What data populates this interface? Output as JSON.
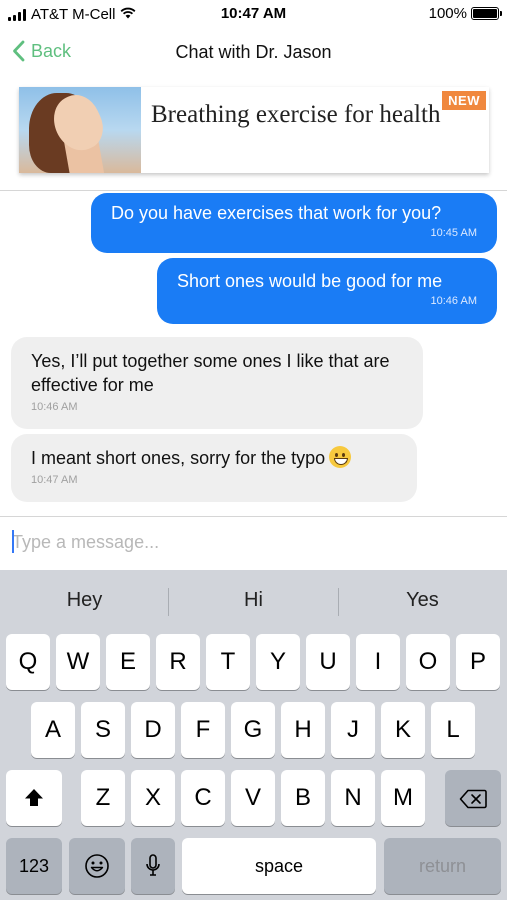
{
  "status_bar": {
    "carrier": "AT&T M-Cell",
    "time": "10:47 AM",
    "battery": "100%",
    "battery_level": 1.0
  },
  "nav": {
    "back_label": "Back",
    "title": "Chat with Dr. Jason"
  },
  "banner": {
    "title": "Breathing exercise for health",
    "badge": "NEW"
  },
  "messages": [
    {
      "direction": "outgoing",
      "text": "Do you have exercises that work for you?",
      "time": "10:45 AM"
    },
    {
      "direction": "outgoing",
      "text": "Short ones would be good for me",
      "time": "10:46 AM"
    },
    {
      "direction": "incoming",
      "text": "Yes, I’ll put together some ones I like that are effective for me",
      "time": "10:46 AM"
    },
    {
      "direction": "incoming",
      "text": "I meant short ones, sorry for the typo",
      "time": "10:47 AM",
      "emoji": "grinning-face"
    }
  ],
  "input": {
    "placeholder": "Type a message..."
  },
  "keyboard": {
    "suggestions": [
      "Hey",
      "Hi",
      "Yes"
    ],
    "row1": [
      "Q",
      "W",
      "E",
      "R",
      "T",
      "Y",
      "U",
      "I",
      "O",
      "P"
    ],
    "row2": [
      "A",
      "S",
      "D",
      "F",
      "G",
      "H",
      "J",
      "K",
      "L"
    ],
    "row3": [
      "Z",
      "X",
      "C",
      "V",
      "B",
      "N",
      "M"
    ],
    "numbers_label": "123",
    "space_label": "space",
    "return_label": "return",
    "icons": {
      "shift": "shift-icon",
      "delete": "backspace-icon",
      "emoji": "emoji-icon",
      "mic": "microphone-icon"
    }
  },
  "colors": {
    "accent_green": "#5fbf7f",
    "bubble_outgoing": "#1a7cf5",
    "bubble_incoming": "#efefef",
    "badge": "#f0883e"
  }
}
